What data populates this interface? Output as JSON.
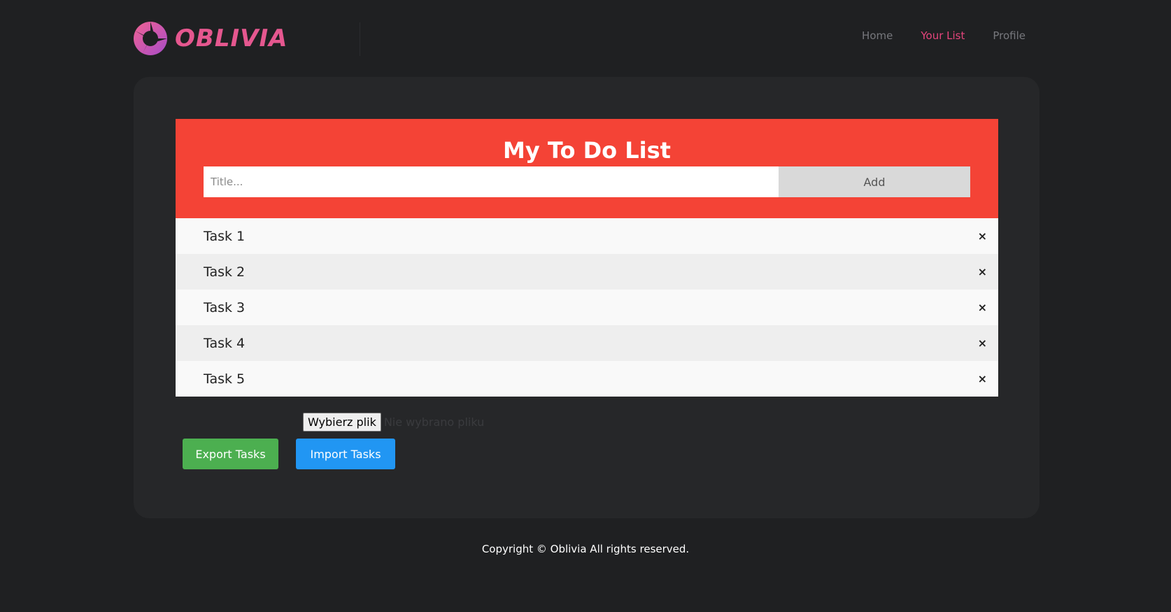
{
  "brand": {
    "name": "OBLIVIA",
    "accent": "#e5578f"
  },
  "nav": {
    "items": [
      {
        "label": "Home",
        "active": false
      },
      {
        "label": "Your List",
        "active": true
      },
      {
        "label": "Profile",
        "active": false
      }
    ]
  },
  "todo": {
    "title": "My To Do List",
    "input_placeholder": "Title...",
    "add_label": "Add",
    "header_color": "#f44336",
    "tasks": [
      {
        "label": "Task 1",
        "close": "×"
      },
      {
        "label": "Task 2",
        "close": "×"
      },
      {
        "label": "Task 3",
        "close": "×"
      },
      {
        "label": "Task 4",
        "close": "×"
      },
      {
        "label": "Task 5",
        "close": "×"
      }
    ]
  },
  "file_input": {
    "button_label": "Wybierz plik",
    "status": "Nie wybrano pliku"
  },
  "actions": {
    "export_label": "Export Tasks",
    "import_label": "Import Tasks",
    "export_color": "#4caf50",
    "import_color": "#2196f3"
  },
  "footer": {
    "text": "Copyright © Oblivia All rights reserved."
  }
}
